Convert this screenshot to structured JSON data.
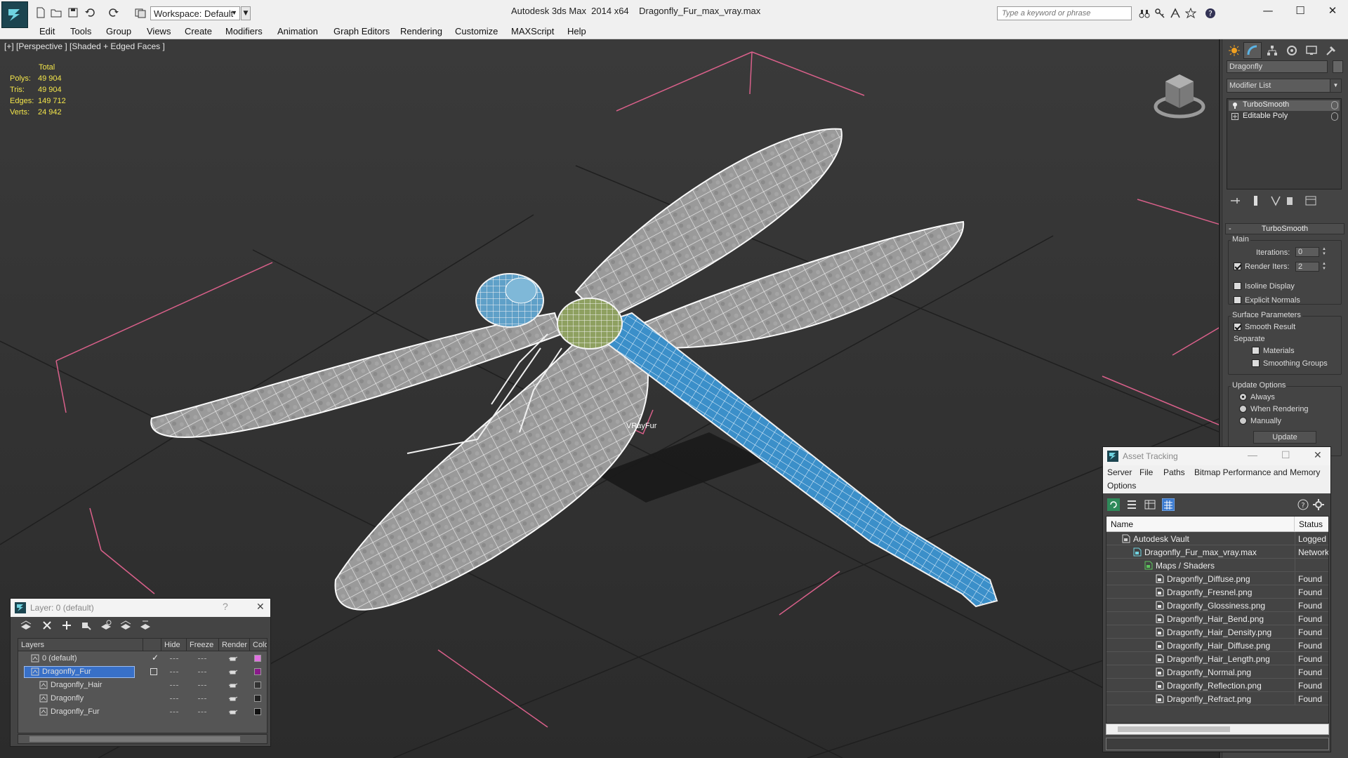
{
  "title_bar": {
    "workspace": "Workspace: Default",
    "app_title": "Autodesk 3ds Max  2014 x64",
    "file_title": "Dragonfly_Fur_max_vray.max",
    "search_placeholder": "Type a keyword or phrase",
    "minimize": "—",
    "maximize": "☐",
    "close": "✕"
  },
  "menu": [
    "Edit",
    "Tools",
    "Group",
    "Views",
    "Create",
    "Modifiers",
    "Animation",
    "Graph Editors",
    "Rendering",
    "Customize",
    "MAXScript",
    "Help"
  ],
  "viewport": {
    "label": "[+] [Perspective ] [Shaded + Edged Faces ]",
    "stats": {
      "header": "Total",
      "rows": [
        {
          "label": "Polys:",
          "value": "49 904"
        },
        {
          "label": "Tris:",
          "value": "49 904"
        },
        {
          "label": "Edges:",
          "value": "149 712"
        },
        {
          "label": "Verts:",
          "value": "24 942"
        }
      ]
    },
    "object_label": "VRayFur"
  },
  "command_panel": {
    "object_name": "Dragonfly",
    "modifier_list": "Modifier List",
    "stack": [
      "TurboSmooth",
      "Editable Poly"
    ],
    "rollout": {
      "title": "TurboSmooth",
      "main_group": "Main",
      "iterations_label": "Iterations:",
      "iterations_value": "0",
      "render_iters_label": "Render Iters:",
      "render_iters_value": "2",
      "render_iters_checked": true,
      "isoline_display": "Isoline Display",
      "explicit_normals": "Explicit Normals",
      "surface_group": "Surface Parameters",
      "smooth_result": "Smooth Result",
      "separate": "Separate",
      "materials": "Materials",
      "smoothing_groups": "Smoothing Groups",
      "update_group": "Update Options",
      "always": "Always",
      "when_rendering": "When Rendering",
      "manually": "Manually",
      "update_button": "Update"
    }
  },
  "layer_window": {
    "title": "Layer: 0 (default)",
    "help": "?",
    "close": "✕",
    "columns": [
      "Layers",
      "Hide",
      "Freeze",
      "Render",
      "Color"
    ],
    "rows": [
      {
        "name": "0 (default)",
        "indent": 0,
        "color": "#e070e0",
        "checked": true,
        "selected": false
      },
      {
        "name": "Dragonfly_Fur",
        "indent": 0,
        "color": "#8a1a8a",
        "checked": false,
        "selected": true
      },
      {
        "name": "Dragonfly_Hair",
        "indent": 1,
        "color": "#333333",
        "checked": false,
        "selected": false
      },
      {
        "name": "Dragonfly",
        "indent": 1,
        "color": "#222222",
        "checked": false,
        "selected": false
      },
      {
        "name": "Dragonfly_Fur",
        "indent": 1,
        "color": "#111111",
        "checked": false,
        "selected": false
      }
    ]
  },
  "asset_window": {
    "title": "Asset Tracking",
    "minimize": "—",
    "maximize": "☐",
    "close": "✕",
    "menu": [
      "Server",
      "File",
      "Paths",
      "Bitmap Performance and Memory",
      "Options"
    ],
    "columns": [
      "Name",
      "Status"
    ],
    "rows": [
      {
        "name": "Autodesk Vault",
        "status": "Logged C",
        "indent": 1,
        "icon": "vault-icon"
      },
      {
        "name": "Dragonfly_Fur_max_vray.max",
        "status": "Network",
        "indent": 2,
        "icon": "max-file-icon"
      },
      {
        "name": "Maps / Shaders",
        "status": "",
        "indent": 3,
        "icon": "maps-icon"
      },
      {
        "name": "Dragonfly_Diffuse.png",
        "status": "Found",
        "indent": 4,
        "icon": "image-file-icon"
      },
      {
        "name": "Dragonfly_Fresnel.png",
        "status": "Found",
        "indent": 4,
        "icon": "image-file-icon"
      },
      {
        "name": "Dragonfly_Glossiness.png",
        "status": "Found",
        "indent": 4,
        "icon": "image-file-icon"
      },
      {
        "name": "Dragonfly_Hair_Bend.png",
        "status": "Found",
        "indent": 4,
        "icon": "image-file-icon"
      },
      {
        "name": "Dragonfly_Hair_Density.png",
        "status": "Found",
        "indent": 4,
        "icon": "image-file-icon"
      },
      {
        "name": "Dragonfly_Hair_Diffuse.png",
        "status": "Found",
        "indent": 4,
        "icon": "image-file-icon"
      },
      {
        "name": "Dragonfly_Hair_Length.png",
        "status": "Found",
        "indent": 4,
        "icon": "image-file-icon"
      },
      {
        "name": "Dragonfly_Normal.png",
        "status": "Found",
        "indent": 4,
        "icon": "image-file-icon"
      },
      {
        "name": "Dragonfly_Reflection.png",
        "status": "Found",
        "indent": 4,
        "icon": "image-file-icon"
      },
      {
        "name": "Dragonfly_Refract.png",
        "status": "Found",
        "indent": 4,
        "icon": "image-file-icon"
      }
    ]
  },
  "colors": {
    "stats_yellow": "#f3e54a",
    "selection_blue": "#3870c8",
    "dragonfly_body_blue": "#3b8fc9",
    "grid_red": "#d9608a"
  }
}
